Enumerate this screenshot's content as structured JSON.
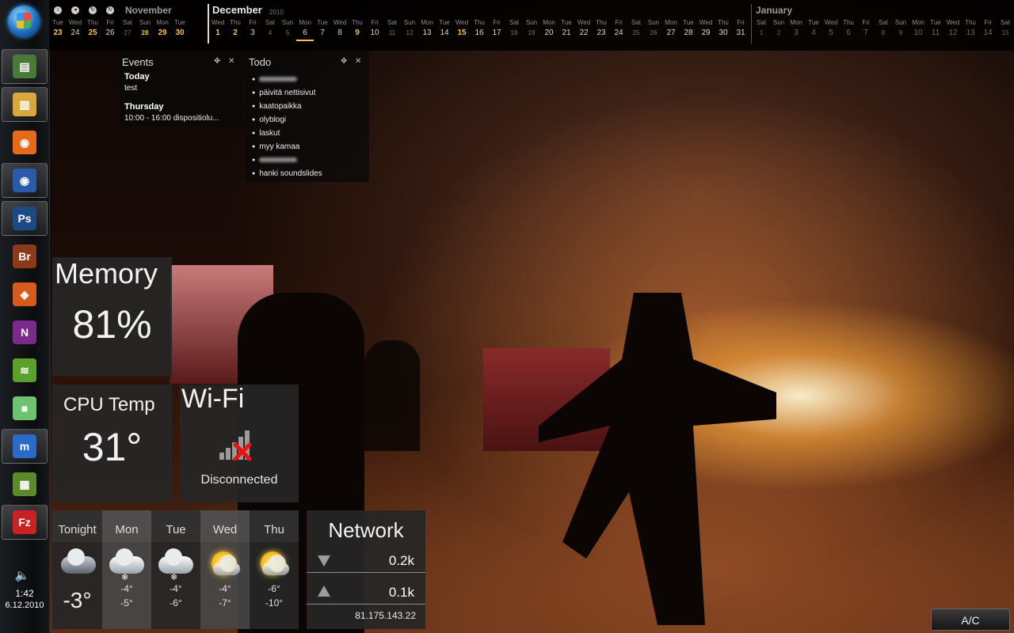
{
  "taskbar": {
    "apps": [
      {
        "name": "system-monitor-icon",
        "glyph": "▤",
        "color": "#4a7a3a"
      },
      {
        "name": "explorer-icon",
        "glyph": "▥",
        "color": "#d8a83a"
      },
      {
        "name": "firefox-icon",
        "glyph": "◉",
        "color": "#e66a1a"
      },
      {
        "name": "thunderbird-icon",
        "glyph": "◉",
        "color": "#2a5aa8"
      },
      {
        "name": "photoshop-icon",
        "glyph": "Ps",
        "color": "#1b4a86"
      },
      {
        "name": "bridge-icon",
        "glyph": "Br",
        "color": "#8a3a18"
      },
      {
        "name": "faststone-icon",
        "glyph": "◈",
        "color": "#d65c1e"
      },
      {
        "name": "onenote-icon",
        "glyph": "N",
        "color": "#7a2a8a"
      },
      {
        "name": "spotify-icon",
        "glyph": "≋",
        "color": "#5aa02a"
      },
      {
        "name": "small-app-icon",
        "glyph": "■",
        "color": "#6ec36e"
      },
      {
        "name": "messenger-icon",
        "glyph": "m",
        "color": "#2a6ac8"
      },
      {
        "name": "minecraft-icon",
        "glyph": "▦",
        "color": "#5a8a2a"
      },
      {
        "name": "filezilla-icon",
        "glyph": "Fz",
        "color": "#c82222"
      }
    ],
    "tray_time": "1:42",
    "tray_date": "6.12.2010"
  },
  "calendar": {
    "nov": {
      "name": "November",
      "days": [
        [
          "Tue",
          "23"
        ],
        [
          "Wed",
          "24"
        ],
        [
          "Thu",
          "25"
        ],
        [
          "Fri",
          "26"
        ],
        [
          "Sat",
          "27"
        ],
        [
          "Sun",
          "28"
        ],
        [
          "Mon",
          "29"
        ],
        [
          "Tue",
          "30"
        ]
      ],
      "highlight": [
        "23",
        "25",
        "28",
        "29",
        "30"
      ]
    },
    "dec": {
      "name": "December",
      "year": "2010",
      "days": [
        [
          "Wed",
          "1"
        ],
        [
          "Thu",
          "2"
        ],
        [
          "Fri",
          "3"
        ],
        [
          "Sat",
          "4"
        ],
        [
          "Sun",
          "5"
        ],
        [
          "Mon",
          "6"
        ],
        [
          "Tue",
          "7"
        ],
        [
          "Wed",
          "8"
        ],
        [
          "Thu",
          "9"
        ],
        [
          "Fri",
          "10"
        ],
        [
          "Sat",
          "11"
        ],
        [
          "Sun",
          "12"
        ],
        [
          "Mon",
          "13"
        ],
        [
          "Tue",
          "14"
        ],
        [
          "Wed",
          "15"
        ],
        [
          "Thu",
          "16"
        ],
        [
          "Fri",
          "17"
        ],
        [
          "Sat",
          "18"
        ],
        [
          "Sun",
          "19"
        ],
        [
          "Mon",
          "20"
        ],
        [
          "Tue",
          "21"
        ],
        [
          "Wed",
          "22"
        ],
        [
          "Thu",
          "23"
        ],
        [
          "Fri",
          "24"
        ],
        [
          "Sat",
          "25"
        ],
        [
          "Sun",
          "26"
        ],
        [
          "Mon",
          "27"
        ],
        [
          "Tue",
          "28"
        ],
        [
          "Wed",
          "29"
        ],
        [
          "Thu",
          "30"
        ],
        [
          "Fri",
          "31"
        ]
      ],
      "highlight": [
        "1",
        "2",
        "9",
        "15"
      ],
      "today": "6"
    },
    "jan": {
      "name": "January",
      "days": [
        [
          "Sat",
          "1"
        ],
        [
          "Sun",
          "2"
        ],
        [
          "Mon",
          "3"
        ],
        [
          "Tue",
          "4"
        ],
        [
          "Wed",
          "5"
        ],
        [
          "Thu",
          "6"
        ],
        [
          "Fri",
          "7"
        ],
        [
          "Sat",
          "8"
        ],
        [
          "Sun",
          "9"
        ],
        [
          "Mon",
          "10"
        ],
        [
          "Tue",
          "11"
        ],
        [
          "Wed",
          "12"
        ],
        [
          "Thu",
          "13"
        ],
        [
          "Fri",
          "14"
        ],
        [
          "Sat",
          "15"
        ]
      ]
    }
  },
  "events": {
    "title": "Events",
    "today_label": "Today",
    "today_item": "test",
    "thursday_label": "Thursday",
    "thursday_item": "10:00 - 16:00 dispositiolu..."
  },
  "todo": {
    "title": "Todo",
    "items": [
      "",
      "päivitä nettisivut",
      "kaatopaikka",
      "olyblogi",
      "laskut",
      "myy kamaa",
      "",
      "hanki soundslides"
    ]
  },
  "memory": {
    "title": "Memory",
    "value": "81%"
  },
  "cpu": {
    "title": "CPU Temp",
    "value": "31°"
  },
  "wifi": {
    "title": "Wi-Fi",
    "status": "Disconnected"
  },
  "weather": {
    "days": [
      {
        "label": "Tonight",
        "temp": "-3°",
        "icon": "partly-cloudy-night-icon"
      },
      {
        "label": "Mon",
        "hi": "-4°",
        "lo": "-5°",
        "icon": "snow-icon"
      },
      {
        "label": "Tue",
        "hi": "-4°",
        "lo": "-6°",
        "icon": "snow-icon"
      },
      {
        "label": "Wed",
        "hi": "-4°",
        "lo": "-7°",
        "icon": "partly-sunny-icon"
      },
      {
        "label": "Thu",
        "hi": "-6°",
        "lo": "-10°",
        "icon": "partly-sunny-icon"
      }
    ]
  },
  "network": {
    "title": "Network",
    "down": "0.2k",
    "up": "0.1k",
    "ip": "81.175.143.22"
  },
  "ac_button": "A/C"
}
